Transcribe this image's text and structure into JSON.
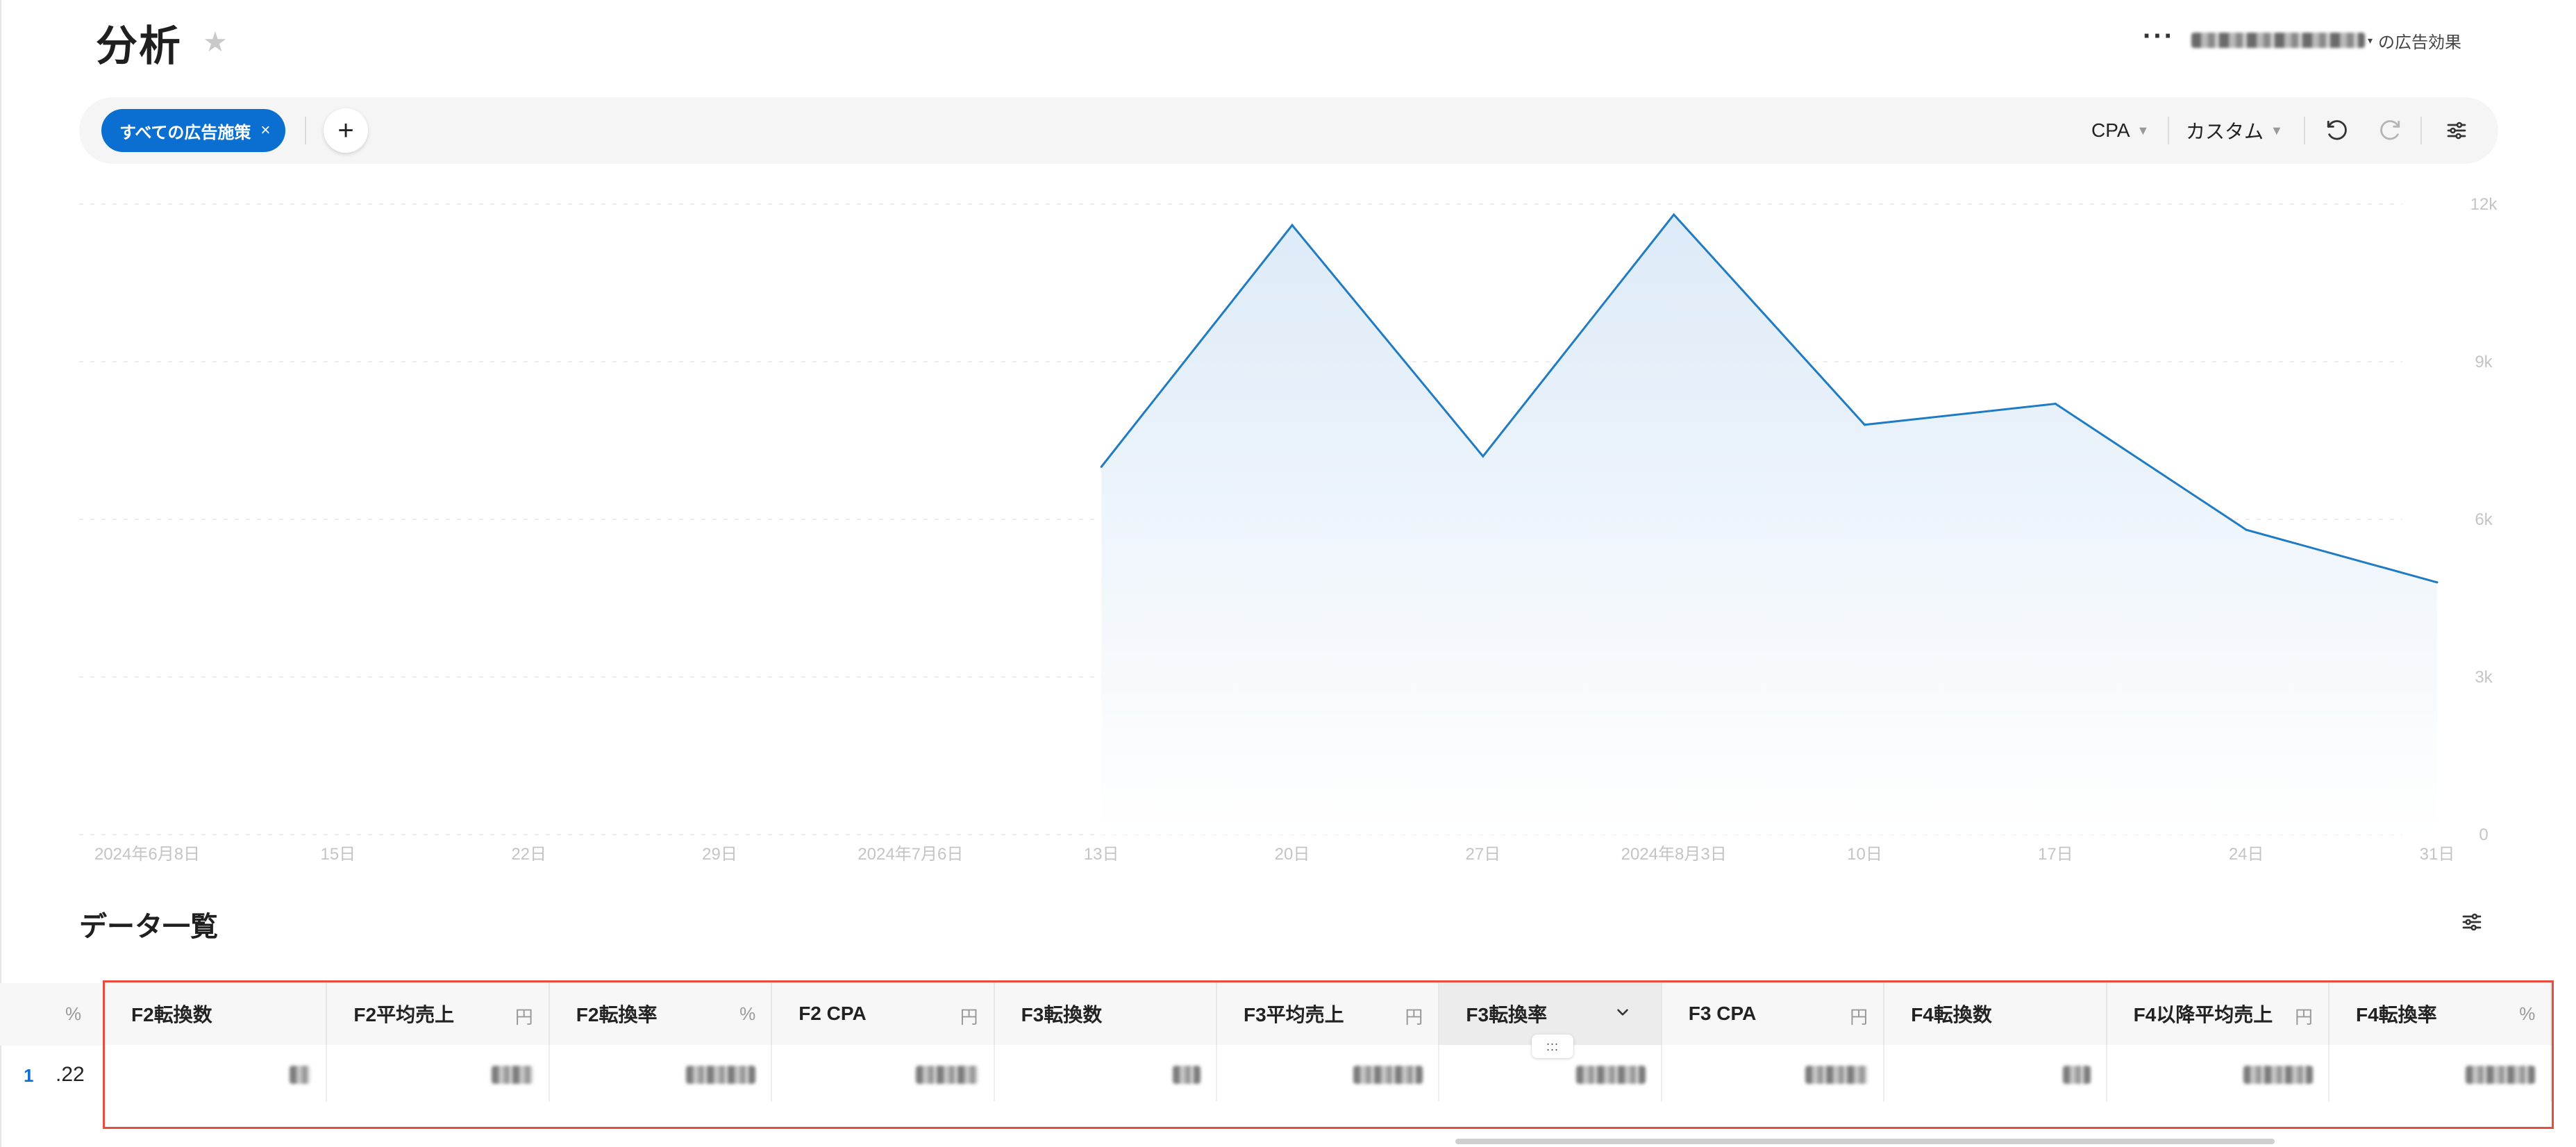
{
  "page": {
    "title": "分析"
  },
  "header": {
    "account_suffix": "の広告効果"
  },
  "toolbar": {
    "filter_chip": "すべての広告施策",
    "chip_close": "×",
    "add": "+",
    "metric_select": "CPA",
    "range_select": "カスタム"
  },
  "icons": {
    "favorite": "star-icon",
    "more": "more-horizontal-icon",
    "undo": "undo-icon",
    "redo": "redo-icon",
    "settings": "sliders-icon",
    "column_menu": "chevron-down-icon",
    "resize": "drag-handle-icon"
  },
  "colors": {
    "accent": "#0b6fd1",
    "highlight_border": "#e74c3c",
    "line": "#1f7bc4"
  },
  "chart_data": {
    "type": "area",
    "y_ticks": [
      "0",
      "3k",
      "6k",
      "9k",
      "12k"
    ],
    "ylim": [
      0,
      12000
    ],
    "x_ticks": [
      "2024年6月8日",
      "15日",
      "22日",
      "29日",
      "2024年7月6日",
      "13日",
      "20日",
      "27日",
      "2024年8月3日",
      "10日",
      "17日",
      "24日",
      "31日"
    ],
    "grid": true,
    "series": [
      {
        "x": [
          "2024-07-13",
          "2024-07-20",
          "2024-07-27",
          "2024-08-03",
          "2024-08-10",
          "2024-08-17",
          "2024-08-24",
          "2024-08-31"
        ],
        "values": [
          7000,
          11600,
          7200,
          11800,
          7800,
          8200,
          5800,
          4800
        ]
      }
    ]
  },
  "data_section": {
    "title": "データ一覧"
  },
  "table": {
    "left_unit": "%",
    "row_number": "1",
    "row_partial_value": ".22",
    "handle": ":::",
    "columns": [
      {
        "label": "F2転換数",
        "unit": ""
      },
      {
        "label": "F2平均売上",
        "unit": "円"
      },
      {
        "label": "F2転換率",
        "unit": "%"
      },
      {
        "label": "F2 CPA",
        "unit": "円"
      },
      {
        "label": "F3転換数",
        "unit": ""
      },
      {
        "label": "F3平均売上",
        "unit": "円"
      },
      {
        "label": "F3転換率",
        "unit": ""
      },
      {
        "label": "F3 CPA",
        "unit": "円"
      },
      {
        "label": "F4転換数",
        "unit": ""
      },
      {
        "label": "F4以降平均売上",
        "unit": "円"
      },
      {
        "label": "F4転換率",
        "unit": "%"
      }
    ]
  }
}
